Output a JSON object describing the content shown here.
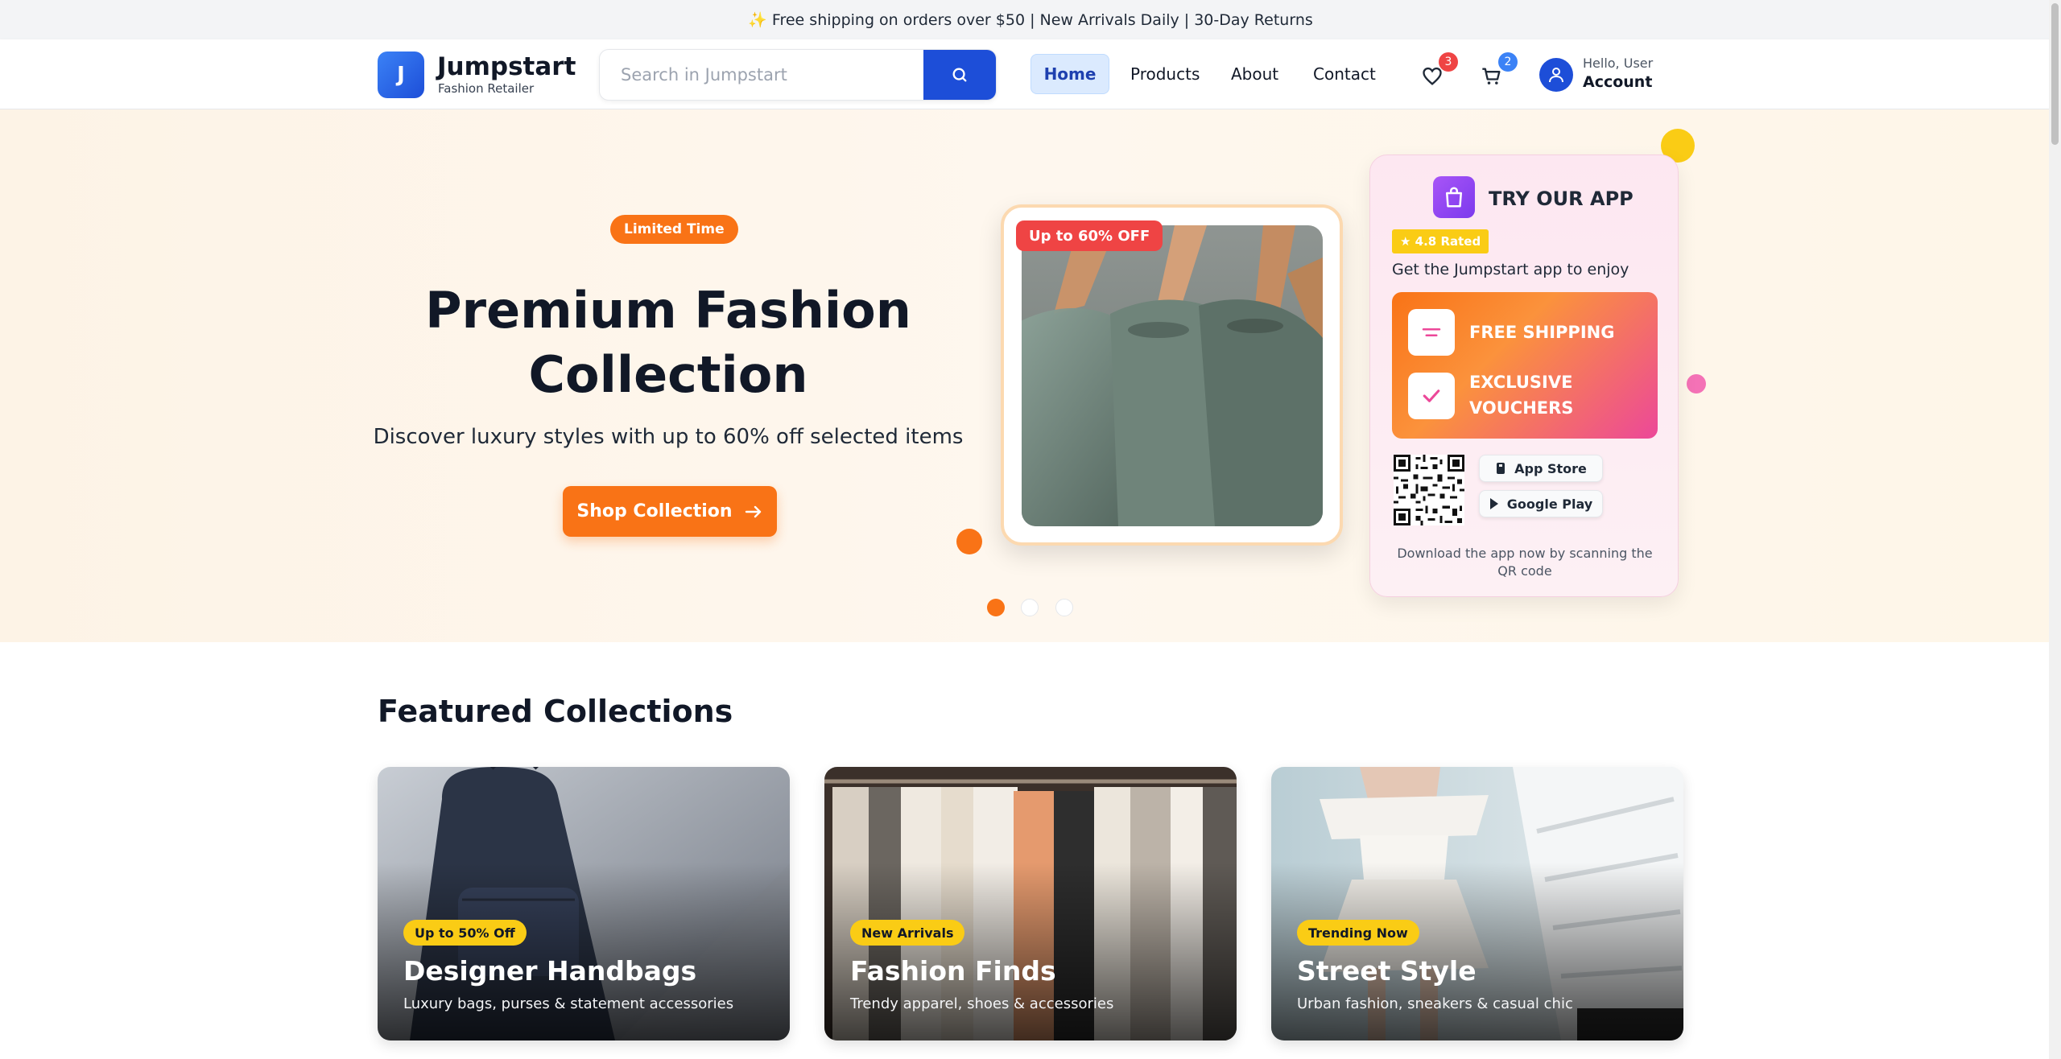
{
  "announcement": "✨ Free shipping on orders over $50 | New Arrivals Daily | 30-Day Returns",
  "header": {
    "logo_letter": "J",
    "brand": "Jumpstart",
    "brand_sub": "Fashion Retailer",
    "search_placeholder": "Search in Jumpstart",
    "nav": [
      "Home",
      "Products",
      "About",
      "Contact"
    ],
    "active_nav": "Home",
    "wishlist_count": "3",
    "cart_count": "2",
    "greeting": "Hello, User",
    "account": "Account"
  },
  "hero": {
    "badge": "Limited Time",
    "title_line1": "Premium Fashion",
    "title_line2": "Collection",
    "subtitle": "Discover luxury styles with up to 60% off selected items",
    "cta": "Shop Collection",
    "image_badge": "Up to 60% OFF",
    "slides": 3,
    "active_slide": 1
  },
  "app_promo": {
    "title": "TRY OUR APP",
    "rating": "★ 4.8 Rated",
    "tagline": "Get the Jumpstart app to enjoy",
    "perks": [
      "FREE SHIPPING",
      "EXCLUSIVE VOUCHERS"
    ],
    "stores": [
      "App Store",
      "Google Play"
    ],
    "note": "Download the app now by scanning the QR code"
  },
  "featured": {
    "heading": "Featured Collections",
    "cards": [
      {
        "badge": "Up to 50% Off",
        "title": "Designer Handbags",
        "desc": "Luxury bags, purses & statement accessories"
      },
      {
        "badge": "New Arrivals",
        "title": "Fashion Finds",
        "desc": "Trendy apparel, shoes & accessories"
      },
      {
        "badge": "Trending Now",
        "title": "Street Style",
        "desc": "Urban fashion, sneakers & casual chic"
      }
    ]
  },
  "colors": {
    "primary": "#1d4ed8",
    "accent": "#f97316",
    "sale": "#ef4444",
    "highlight": "#facc15",
    "pink": "#ec4899"
  },
  "icons": [
    "search-icon",
    "heart-icon",
    "cart-icon",
    "user-icon",
    "arrow-right-icon",
    "shopping-bag-icon",
    "shipping-icon",
    "check-icon",
    "qr-code-icon",
    "apple-icon",
    "play-icon"
  ]
}
